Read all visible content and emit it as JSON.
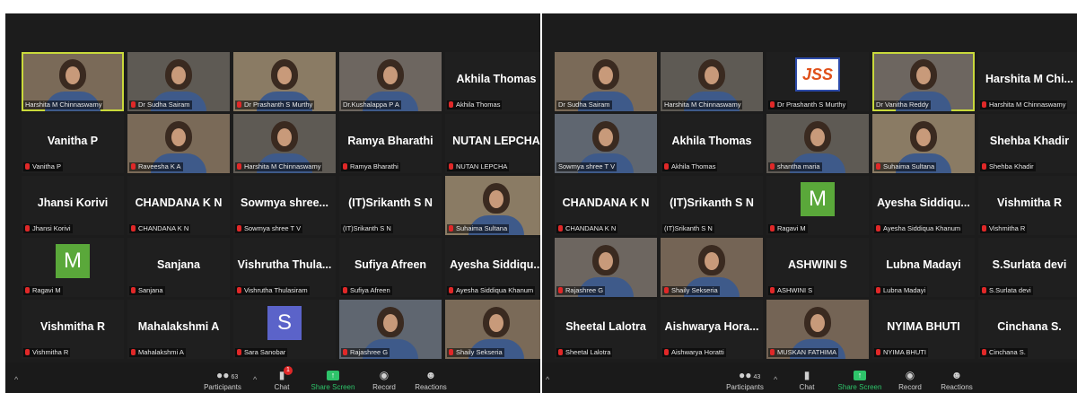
{
  "left": {
    "tiles": [
      {
        "name": "",
        "label": "Harshita M Chinnaswamy",
        "kind": "photo",
        "speaking": true,
        "mic": false
      },
      {
        "name": "",
        "label": "Dr Sudha Sairam",
        "kind": "photo",
        "speaking": false,
        "mic": true
      },
      {
        "name": "",
        "label": "Dr Prashanth S Murthy",
        "kind": "photo",
        "speaking": false,
        "mic": true
      },
      {
        "name": "",
        "label": "Dr.Kushalappa P A",
        "kind": "photo",
        "speaking": false,
        "mic": false
      },
      {
        "name": "Akhila Thomas",
        "label": "Akhila Thomas",
        "kind": "name",
        "speaking": false,
        "mic": true
      },
      {
        "name": "Vanitha P",
        "label": "Vanitha P",
        "kind": "name",
        "speaking": false,
        "mic": true
      },
      {
        "name": "",
        "label": "Raveesha K A",
        "kind": "photo",
        "speaking": false,
        "mic": true
      },
      {
        "name": "",
        "label": "Harshita M Chinnaswamy",
        "kind": "photo",
        "speaking": false,
        "mic": true
      },
      {
        "name": "Ramya Bharathi",
        "label": "Ramya Bharathi",
        "kind": "name",
        "speaking": false,
        "mic": true
      },
      {
        "name": "NUTAN LEPCHA",
        "label": "NUTAN LEPCHA",
        "kind": "name",
        "speaking": false,
        "mic": true
      },
      {
        "name": "Jhansi Korivi",
        "label": "Jhansi Korivi",
        "kind": "name",
        "speaking": false,
        "mic": true
      },
      {
        "name": "CHANDANA K N",
        "label": "CHANDANA K N",
        "kind": "name",
        "speaking": false,
        "mic": true
      },
      {
        "name": "Sowmya shree...",
        "label": "Sowmya shree T V",
        "kind": "name",
        "speaking": false,
        "mic": true
      },
      {
        "name": "(IT)Srikanth S N",
        "label": "(IT)Srikanth S N",
        "kind": "name",
        "speaking": false,
        "mic": false
      },
      {
        "name": "",
        "label": "Suhaima Sultana",
        "kind": "photo",
        "speaking": false,
        "mic": true
      },
      {
        "name": "",
        "label": "Ragavi M",
        "kind": "avatar",
        "avatar": "M",
        "avatarColor": "#5aa83a",
        "speaking": false,
        "mic": true
      },
      {
        "name": "Sanjana",
        "label": "Sanjana",
        "kind": "name",
        "speaking": false,
        "mic": true
      },
      {
        "name": "Vishrutha Thula...",
        "label": "Vishrutha Thulasiram",
        "kind": "name",
        "speaking": false,
        "mic": true
      },
      {
        "name": "Sufiya Afreen",
        "label": "Sufiya Afreen",
        "kind": "name",
        "speaking": false,
        "mic": true
      },
      {
        "name": "Ayesha Siddiqu...",
        "label": "Ayesha Siddiqua Khanum",
        "kind": "name",
        "speaking": false,
        "mic": true
      },
      {
        "name": "Vishmitha R",
        "label": "Vishmitha R",
        "kind": "name",
        "speaking": false,
        "mic": true
      },
      {
        "name": "Mahalakshmi A",
        "label": "Mahalakshmi A",
        "kind": "name",
        "speaking": false,
        "mic": true
      },
      {
        "name": "",
        "label": "Sara Sanobar",
        "kind": "avatar",
        "avatar": "S",
        "avatarColor": "#5b63c9",
        "speaking": false,
        "mic": true
      },
      {
        "name": "",
        "label": "Rajashree G",
        "kind": "photo",
        "speaking": false,
        "mic": true
      },
      {
        "name": "",
        "label": "Shaily Sekseria",
        "kind": "photo",
        "speaking": false,
        "mic": true
      }
    ],
    "toolbar": {
      "participants": "Participants",
      "participants_count": "63",
      "chat": "Chat",
      "chat_badge": "1",
      "share": "Share Screen",
      "record": "Record",
      "reactions": "Reactions"
    }
  },
  "right": {
    "tiles": [
      {
        "name": "",
        "label": "Dr Sudha Sairam",
        "kind": "photo",
        "speaking": false,
        "mic": false
      },
      {
        "name": "",
        "label": "Harshita M Chinnaswamy",
        "kind": "photo",
        "speaking": false,
        "mic": false
      },
      {
        "name": "",
        "label": "Dr Prashanth S Murthy",
        "kind": "logo",
        "logo": "JSS",
        "speaking": false,
        "mic": true
      },
      {
        "name": "",
        "label": "Dr Vanitha Reddy",
        "kind": "photo",
        "speaking": true,
        "mic": false
      },
      {
        "name": "Harshita M Chi...",
        "label": "Harshita M Chinnaswamy",
        "kind": "name",
        "speaking": false,
        "mic": true
      },
      {
        "name": "",
        "label": "Sowmya shree T V",
        "kind": "photo",
        "speaking": false,
        "mic": false
      },
      {
        "name": "Akhila Thomas",
        "label": "Akhila Thomas",
        "kind": "name",
        "speaking": false,
        "mic": true
      },
      {
        "name": "",
        "label": "shantha maria",
        "kind": "photo",
        "speaking": false,
        "mic": true
      },
      {
        "name": "",
        "label": "Suhaima Sultana",
        "kind": "photo",
        "speaking": false,
        "mic": true
      },
      {
        "name": "Shehba Khadir",
        "label": "Shehba Khadir",
        "kind": "name",
        "speaking": false,
        "mic": true
      },
      {
        "name": "CHANDANA K N",
        "label": "CHANDANA K N",
        "kind": "name",
        "speaking": false,
        "mic": true
      },
      {
        "name": "(IT)Srikanth S N",
        "label": "(IT)Srikanth S N",
        "kind": "name",
        "speaking": false,
        "mic": false
      },
      {
        "name": "",
        "label": "Ragavi M",
        "kind": "avatar",
        "avatar": "M",
        "avatarColor": "#5aa83a",
        "speaking": false,
        "mic": true
      },
      {
        "name": "Ayesha Siddiqu...",
        "label": "Ayesha Siddiqua Khanum",
        "kind": "name",
        "speaking": false,
        "mic": true
      },
      {
        "name": "Vishmitha R",
        "label": "Vishmitha R",
        "kind": "name",
        "speaking": false,
        "mic": true
      },
      {
        "name": "",
        "label": "Rajashree G",
        "kind": "photo",
        "speaking": false,
        "mic": true
      },
      {
        "name": "",
        "label": "Shaily Sekseria",
        "kind": "photo",
        "speaking": false,
        "mic": true
      },
      {
        "name": "ASHWINI S",
        "label": "ASHWINI S",
        "kind": "name",
        "speaking": false,
        "mic": true
      },
      {
        "name": "Lubna Madayi",
        "label": "Lubna Madayi",
        "kind": "name",
        "speaking": false,
        "mic": true
      },
      {
        "name": "S.Surlata devi",
        "label": "S.Surlata devi",
        "kind": "name",
        "speaking": false,
        "mic": true
      },
      {
        "name": "Sheetal Lalotra",
        "label": "Sheetal Lalotra",
        "kind": "name",
        "speaking": false,
        "mic": true
      },
      {
        "name": "Aishwarya Hora...",
        "label": "Aishwarya Horatti",
        "kind": "name",
        "speaking": false,
        "mic": true
      },
      {
        "name": "",
        "label": "MUSKAN FATHIMA",
        "kind": "photo",
        "speaking": false,
        "mic": true
      },
      {
        "name": "NYIMA BHUTI",
        "label": "NYIMA BHUTI",
        "kind": "name",
        "speaking": false,
        "mic": true
      },
      {
        "name": "Cinchana S.",
        "label": "Cinchana S.",
        "kind": "name",
        "speaking": false,
        "mic": true
      }
    ],
    "toolbar": {
      "participants": "Participants",
      "participants_count": "43",
      "chat": "Chat",
      "share": "Share Screen",
      "record": "Record",
      "reactions": "Reactions"
    }
  }
}
